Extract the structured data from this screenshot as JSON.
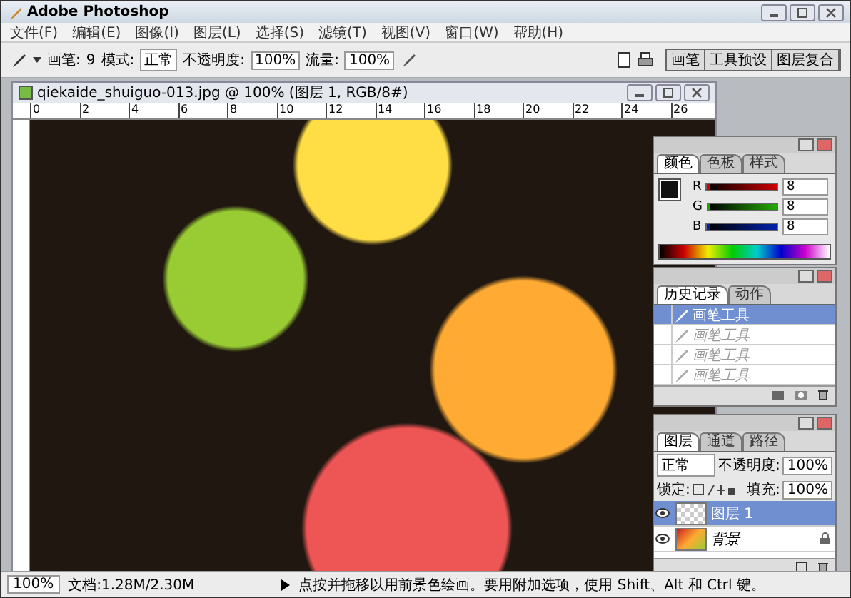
{
  "app": {
    "title": "Adobe Photoshop"
  },
  "menu": [
    "文件(F)",
    "编辑(E)",
    "图像(I)",
    "图层(L)",
    "选择(S)",
    "滤镜(T)",
    "视图(V)",
    "窗口(W)",
    "帮助(H)"
  ],
  "options_bar": {
    "brush_label": "画笔:",
    "brush_size": "9",
    "mode_label": "模式:",
    "mode": "正常",
    "opacity_label": "不透明度:",
    "opacity": "100%",
    "flow_label": "流量:",
    "flow": "100%"
  },
  "palette_well_tabs": [
    "画笔",
    "工具预设",
    "图层复合"
  ],
  "document": {
    "title": "qiekaide_shuiguo-013.jpg @ 100% (图层 1, RGB/8#)",
    "ruler": [
      "0",
      "2",
      "4",
      "6",
      "8",
      "10",
      "12",
      "14",
      "16",
      "18",
      "20",
      "22",
      "24",
      "26"
    ]
  },
  "color_panel": {
    "tabs": [
      {
        "label": "颜色",
        "selected": true
      },
      {
        "label": "色板",
        "selected": false
      },
      {
        "label": "样式",
        "selected": false
      }
    ],
    "channels": [
      {
        "name": "R",
        "value": "8",
        "level": 0.03,
        "color": "#cc0000"
      },
      {
        "name": "G",
        "value": "8",
        "level": 0.03,
        "color": "#22aa00"
      },
      {
        "name": "B",
        "value": "8",
        "level": 0.03,
        "color": "#0022aa"
      }
    ]
  },
  "history_panel": {
    "tabs": [
      {
        "label": "历史记录",
        "selected": true
      },
      {
        "label": "动作",
        "selected": false
      }
    ],
    "items": [
      {
        "label": "画笔工具",
        "selected": true,
        "disabled": false
      },
      {
        "label": "画笔工具",
        "selected": false,
        "disabled": true
      },
      {
        "label": "画笔工具",
        "selected": false,
        "disabled": true
      },
      {
        "label": "画笔工具",
        "selected": false,
        "disabled": true
      }
    ]
  },
  "layers_panel": {
    "tabs": [
      {
        "label": "图层",
        "selected": true
      },
      {
        "label": "通道",
        "selected": false
      },
      {
        "label": "路径",
        "selected": false
      }
    ],
    "blend_mode": "正常",
    "opacity_label": "不透明度:",
    "opacity": "100%",
    "lock_label": "锁定:",
    "fill_label": "填充:",
    "fill": "100%",
    "layers": [
      {
        "name": "图层 1",
        "kind": "transparent",
        "selected": true,
        "visible": true,
        "locked": false
      },
      {
        "name": "背景",
        "kind": "background",
        "selected": false,
        "visible": true,
        "locked": true
      }
    ]
  },
  "status_bar": {
    "zoom": "100%",
    "doc_info": "文档:1.28M/2.30M",
    "hint": "点按并拖移以用前景色绘画。要用附加选项，使用 Shift、Alt 和 Ctrl 键。"
  }
}
